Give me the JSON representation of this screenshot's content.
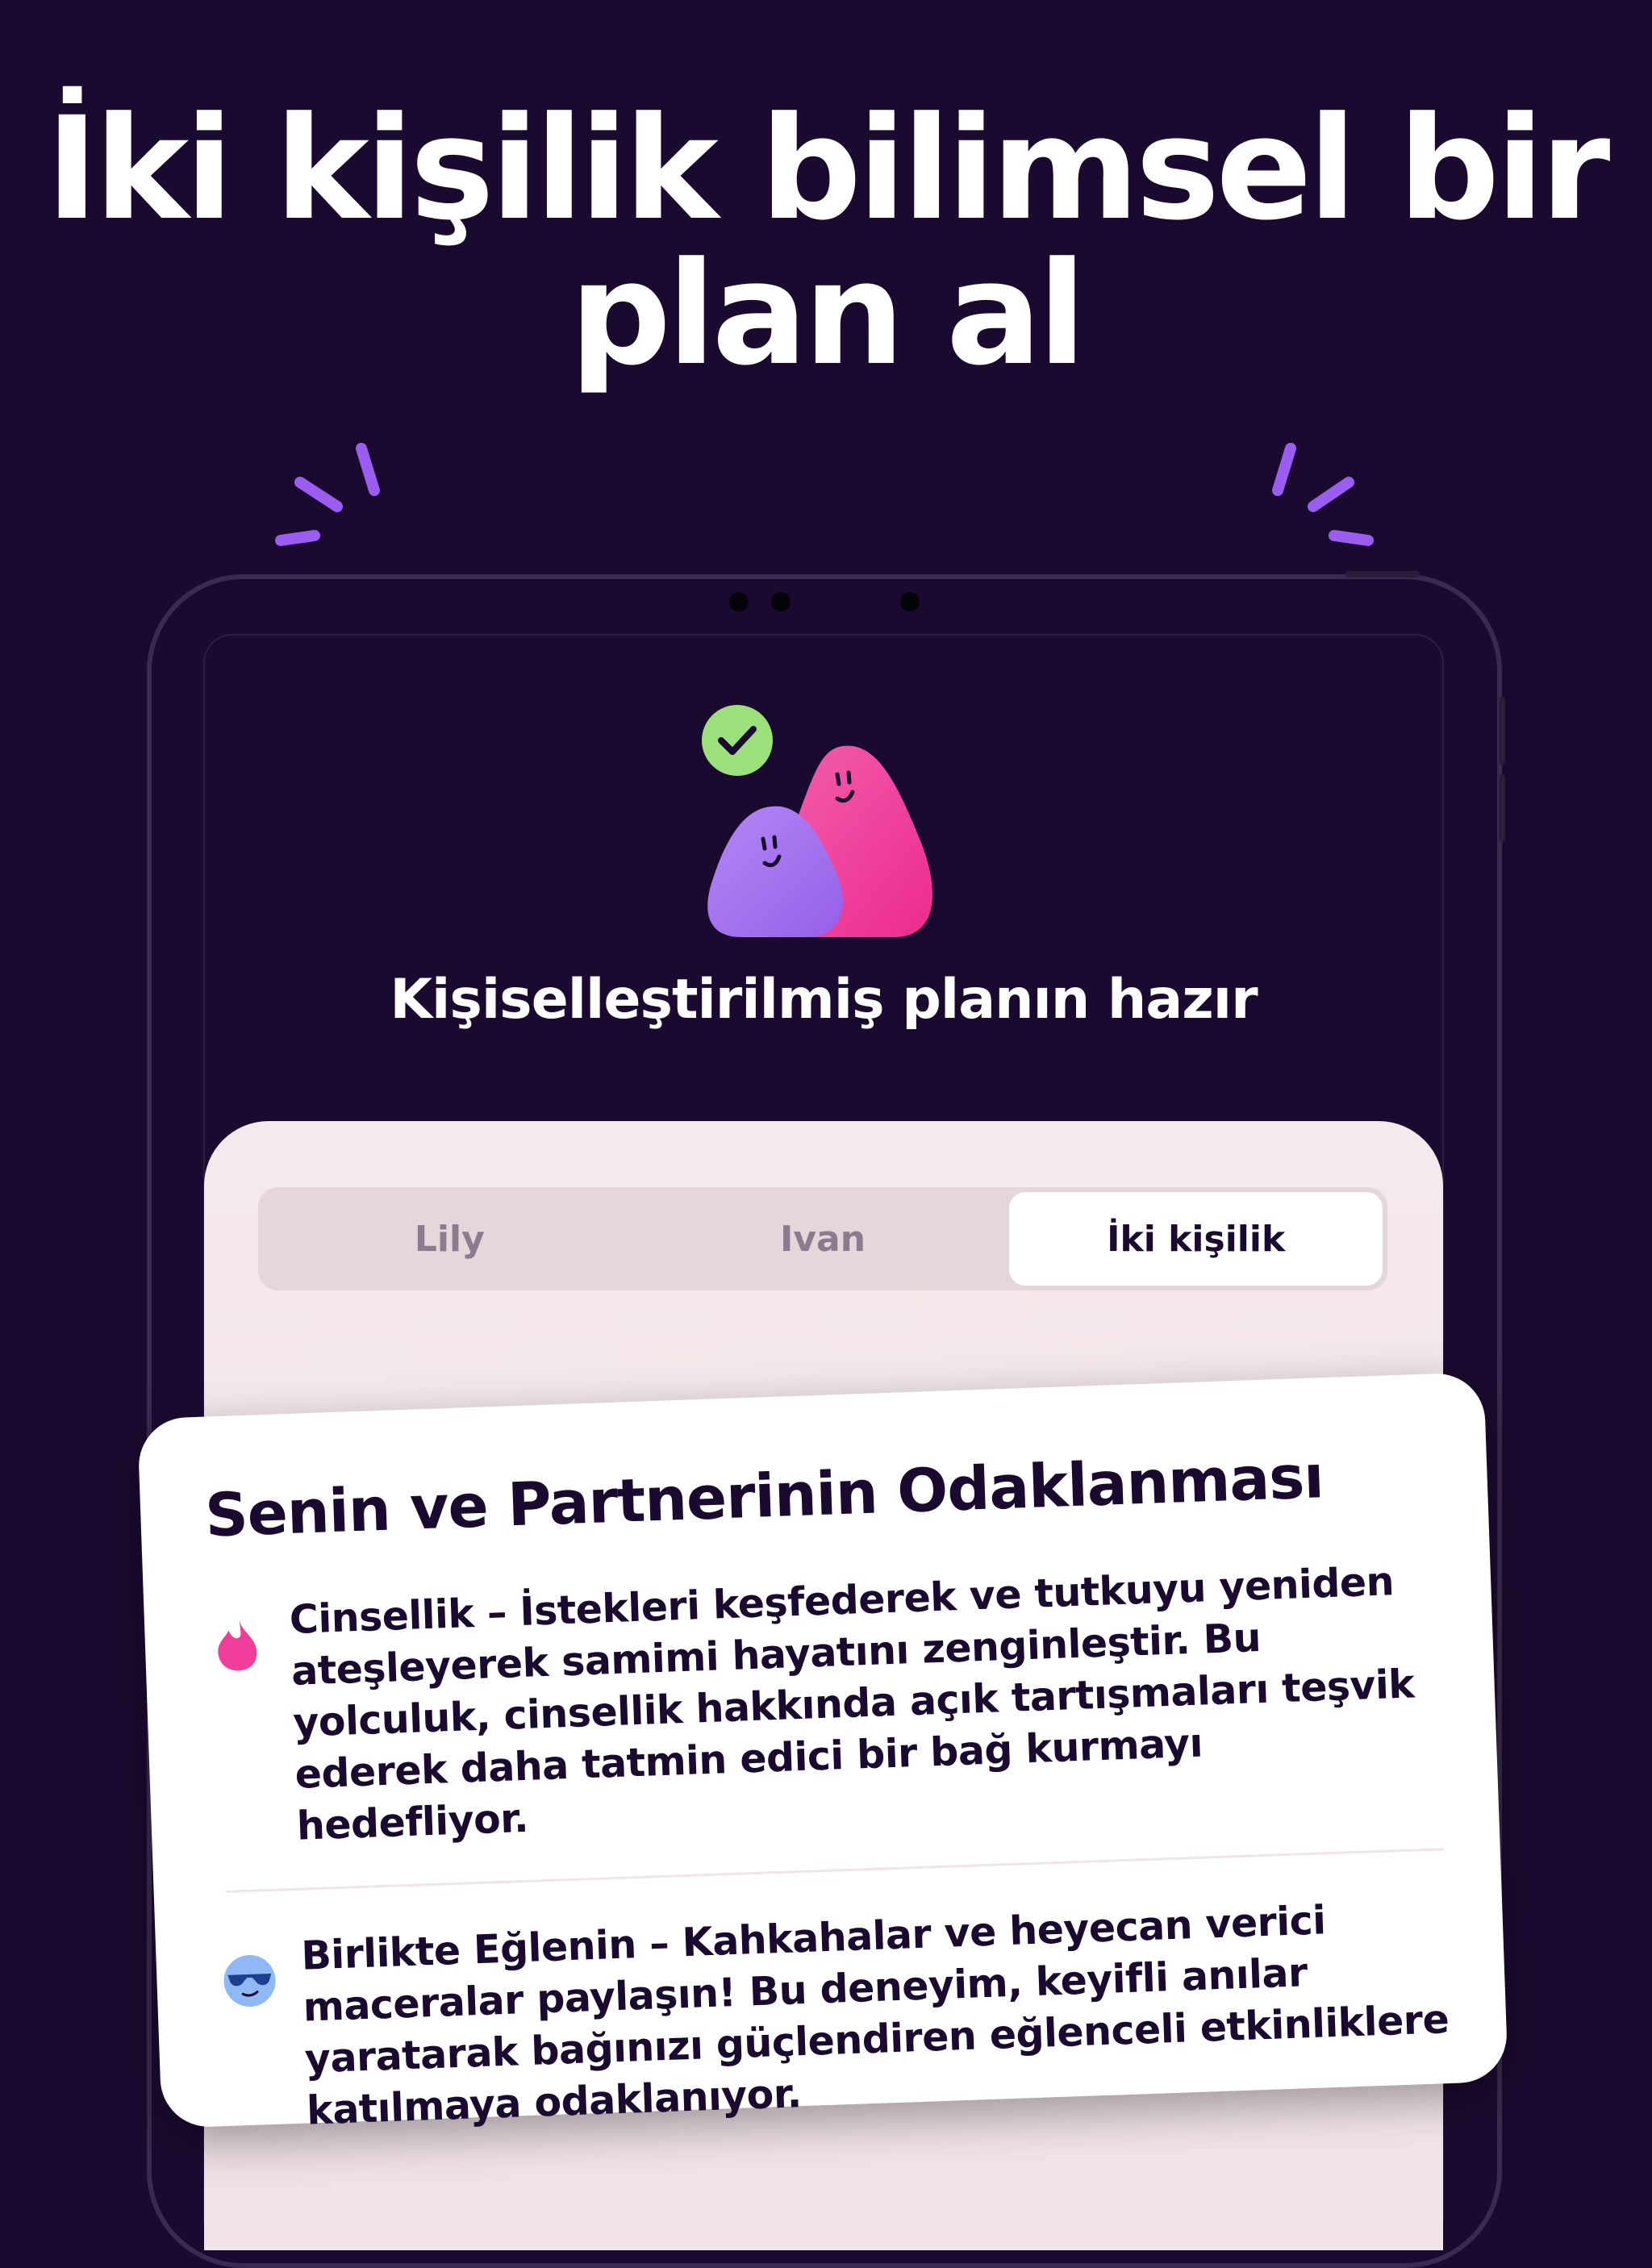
{
  "headline": {
    "line1": "İki kişilik bilimsel bir",
    "line2": "plan al"
  },
  "screen": {
    "status_title": "Kişiselleştirilmiş planın hazır",
    "tabs": [
      {
        "label": "Lily",
        "active": false
      },
      {
        "label": "Ivan",
        "active": false
      },
      {
        "label": "İki kişilik",
        "active": true
      }
    ]
  },
  "card": {
    "title": "Senin ve Partnerinin Odaklanması",
    "items": [
      {
        "icon": "flame-icon",
        "text": "Cinsellik – İstekleri keşfederek ve tutkuyu yeniden ateşleyerek samimi hayatını zenginleştir. Bu yolculuk, cinsellik hakkında açık tartışmaları teşvik ederek daha tatmin edici bir bağ kurmayı hedefliyor."
      },
      {
        "icon": "sunglasses-face-icon",
        "text": "Birlikte Eğlenin – Kahkahalar ve heyecan verici maceralar paylaşın! Bu deneyim, keyifli anılar yaratarak bağınızı güçlendiren eğlenceli etkinliklere katılmaya odaklanıyor."
      }
    ]
  },
  "colors": {
    "background": "#1b0a30",
    "accent_purple": "#a46cf0",
    "accent_pink": "#f03d9a",
    "check_green": "#9be07a",
    "panel": "#f4e9ec"
  }
}
